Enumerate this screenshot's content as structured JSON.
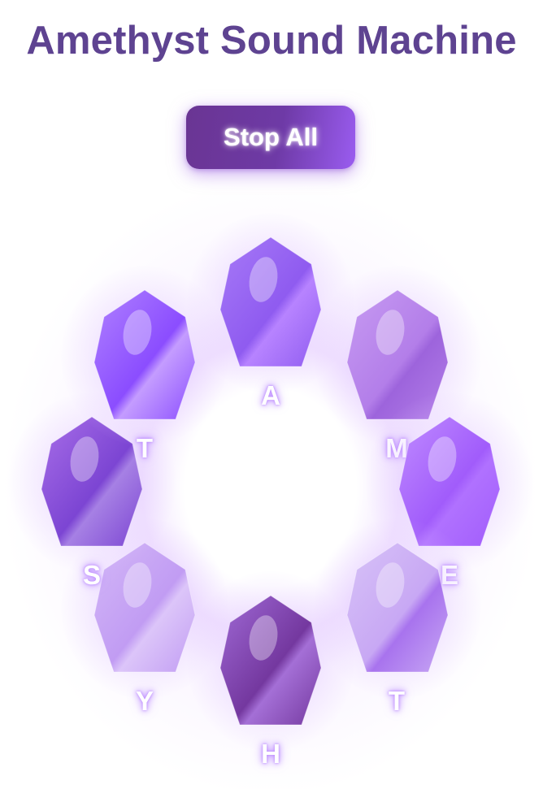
{
  "app": {
    "title": "Amethyst Sound Machine"
  },
  "controls": {
    "stop_all_label": "Stop All"
  },
  "crystals": [
    {
      "id": "a",
      "label": "A",
      "colors": [
        "#a77af7",
        "#8f5bf0",
        "#b783ff"
      ]
    },
    {
      "id": "m",
      "label": "M",
      "colors": [
        "#c79bf2",
        "#b37ee9",
        "#9d64dc"
      ]
    },
    {
      "id": "e",
      "label": "E",
      "colors": [
        "#c08cff",
        "#a15cfb",
        "#b071ff"
      ]
    },
    {
      "id": "t2",
      "label": "T",
      "colors": [
        "#d7c2f7",
        "#c8a8f4",
        "#a873ee"
      ]
    },
    {
      "id": "h",
      "label": "H",
      "colors": [
        "#a06ad6",
        "#74389f",
        "#a46fd6"
      ]
    },
    {
      "id": "y",
      "label": "Y",
      "colors": [
        "#d3b7f7",
        "#c19cf3",
        "#dcc5f9"
      ]
    },
    {
      "id": "s",
      "label": "S",
      "colors": [
        "#a86ee8",
        "#7c45d3",
        "#a680e4"
      ]
    },
    {
      "id": "t1",
      "label": "T",
      "colors": [
        "#b082ff",
        "#8b4dff",
        "#c49cff"
      ]
    }
  ],
  "theme": {
    "title_color": "#5e4391",
    "button_gradient": [
      "#6a3593",
      "#9a5cf0"
    ],
    "label_glow": "#be8cff"
  }
}
